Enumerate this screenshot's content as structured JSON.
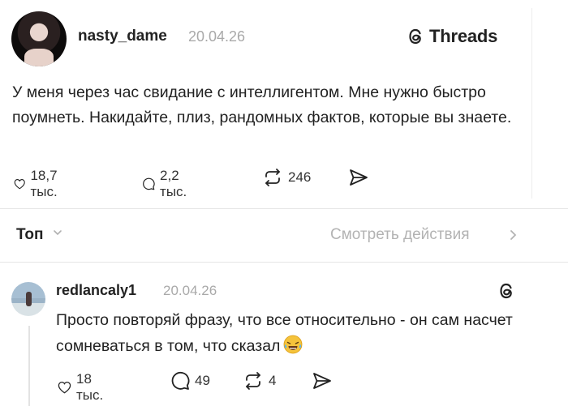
{
  "post": {
    "username": "nasty_dame",
    "date": "20.04.26",
    "brand": "Threads",
    "text": "У меня через час свидание с интеллигентом. Мне нужно быстро поумнеть. Накидайте, плиз, рандомных фактов, которые вы знаете.",
    "likes": "18,7 тыс.",
    "comments": "2,2 тыс.",
    "reposts": "246"
  },
  "sort": {
    "label": "Топ",
    "activity_link": "Смотреть действия"
  },
  "reply": {
    "username": "redlancaly1",
    "date": "20.04.26",
    "text": "Просто повторяй фразу, что все относительно - он сам насчет сомневаться в том, что сказал",
    "emoji": "😂",
    "likes": "18 тыс.",
    "comments": "49",
    "reposts": "4"
  },
  "icons": {
    "brand_logo": "threads-logo-icon",
    "like": "heart-icon",
    "comment": "speech-bubble-icon",
    "repost": "repost-icon",
    "share": "send-icon",
    "sort_chevron": "chevron-down-icon",
    "activity_chevron": "chevron-right-icon",
    "emoji": "tears-of-joy-emoji-icon"
  },
  "colors": {
    "text": "#222222",
    "muted": "#a9a9a9",
    "link_muted": "#b3b3b3",
    "divider": "#e6e6e6"
  }
}
